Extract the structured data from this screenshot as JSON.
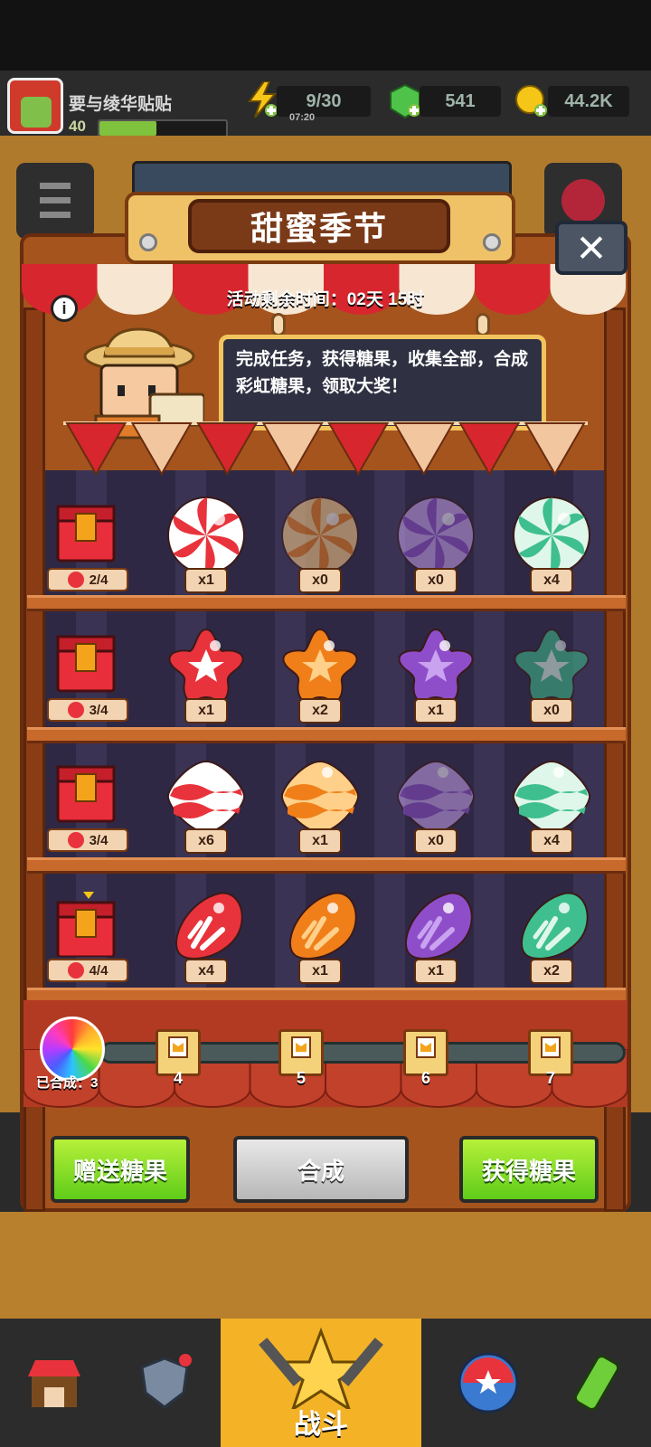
{
  "hud": {
    "player_name": "要与绫华贴贴",
    "level": "40",
    "xp_progress": 0.45,
    "energy": "9/30",
    "energy_timer": "07:20",
    "gems": "541",
    "coins": "44.2K"
  },
  "event": {
    "title": "甜蜜季节",
    "timer_text": "活动剩余时间：02天 15时",
    "description": "完成任务，获得糖果，收集全部，合成彩虹糖果，领取大奖！"
  },
  "candy_rows": [
    {
      "type": "swirl",
      "progress": "2/4",
      "counts": [
        "x1",
        "x0",
        "x0",
        "x4"
      ]
    },
    {
      "type": "star",
      "progress": "3/4",
      "counts": [
        "x1",
        "x2",
        "x1",
        "x0"
      ]
    },
    {
      "type": "wave",
      "progress": "3/4",
      "counts": [
        "x6",
        "x1",
        "x0",
        "x4"
      ]
    },
    {
      "type": "slice",
      "progress": "4/4",
      "counts": [
        "x4",
        "x1",
        "x1",
        "x2"
      ]
    }
  ],
  "candy_colors": {
    "red": {
      "base": "#e8333c",
      "light": "#ffffff",
      "enabled": true
    },
    "orange": {
      "base": "#f07f1a",
      "light": "#ffd089"
    },
    "purple": {
      "base": "#8f4ec9",
      "light": "#c9a2f0"
    },
    "green": {
      "base": "#3fbf8f",
      "light": "#dff7ea"
    }
  },
  "synthesis": {
    "label": "已合成：3",
    "milestones": [
      "4",
      "5",
      "6",
      "7"
    ]
  },
  "buttons": {
    "gift": "赠送糖果",
    "combine": "合成",
    "obtain": "获得糖果"
  },
  "nav": {
    "battle": "战斗"
  }
}
